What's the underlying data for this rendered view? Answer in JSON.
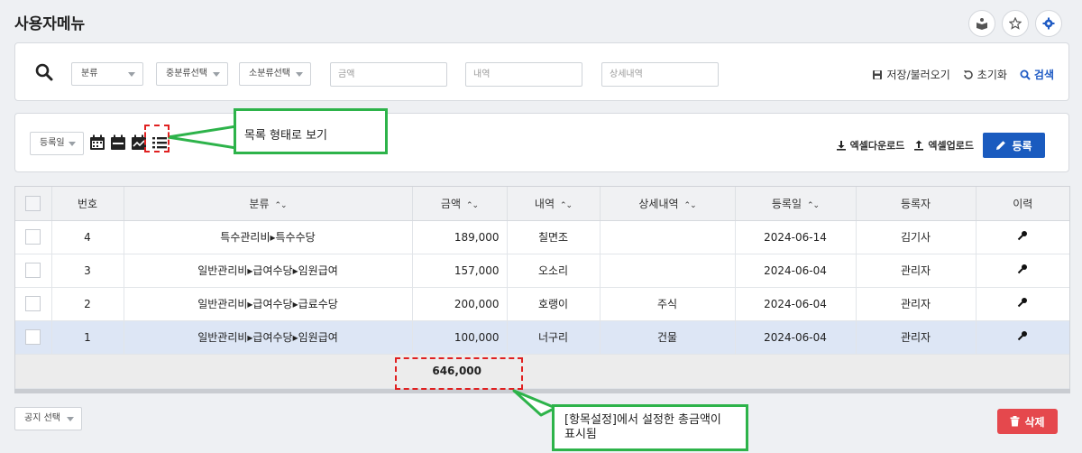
{
  "header": {
    "title": "사용자메뉴"
  },
  "search": {
    "category1": "분류",
    "category2": "중분류선택",
    "category3": "소분류선택",
    "amount_placeholder": "금액",
    "desc_placeholder": "내역",
    "detail_placeholder": "상세내역",
    "save_load": "저장/불러오기",
    "reset": "초기화",
    "search": "검색"
  },
  "toolbar": {
    "date_select": "등록일",
    "excel_download": "엑셀다운로드",
    "excel_upload": "엑셀업로드",
    "register": "등록"
  },
  "callouts": {
    "list_view": "목록 형태로 보기",
    "total_line1": "[항목설정]에서 설정한 총금액이",
    "total_line2": "표시됨"
  },
  "table": {
    "headers": [
      "번호",
      "분류",
      "금액",
      "내역",
      "상세내역",
      "등록일",
      "등록자",
      "이력"
    ],
    "rows": [
      {
        "no": "4",
        "category": "특수관리비▸특수수당",
        "amount": "189,000",
        "desc": "칠면조",
        "detail": "",
        "date": "2024-06-14",
        "user": "김기사"
      },
      {
        "no": "3",
        "category": "일반관리비▸급여수당▸임원급여",
        "amount": "157,000",
        "desc": "오소리",
        "detail": "",
        "date": "2024-06-04",
        "user": "관리자"
      },
      {
        "no": "2",
        "category": "일반관리비▸급여수당▸급료수당",
        "amount": "200,000",
        "desc": "호랭이",
        "detail": "주식",
        "date": "2024-06-04",
        "user": "관리자"
      },
      {
        "no": "1",
        "category": "일반관리비▸급여수당▸임원급여",
        "amount": "100,000",
        "desc": "너구리",
        "detail": "건물",
        "date": "2024-06-04",
        "user": "관리자"
      }
    ],
    "total": "646,000"
  },
  "footer": {
    "notice_select": "공지 선택",
    "delete": "삭제"
  },
  "colors": {
    "primary": "#1a5bbf",
    "danger": "#e5484d",
    "callout_border": "#2db34a",
    "highlight": "#e02020"
  }
}
